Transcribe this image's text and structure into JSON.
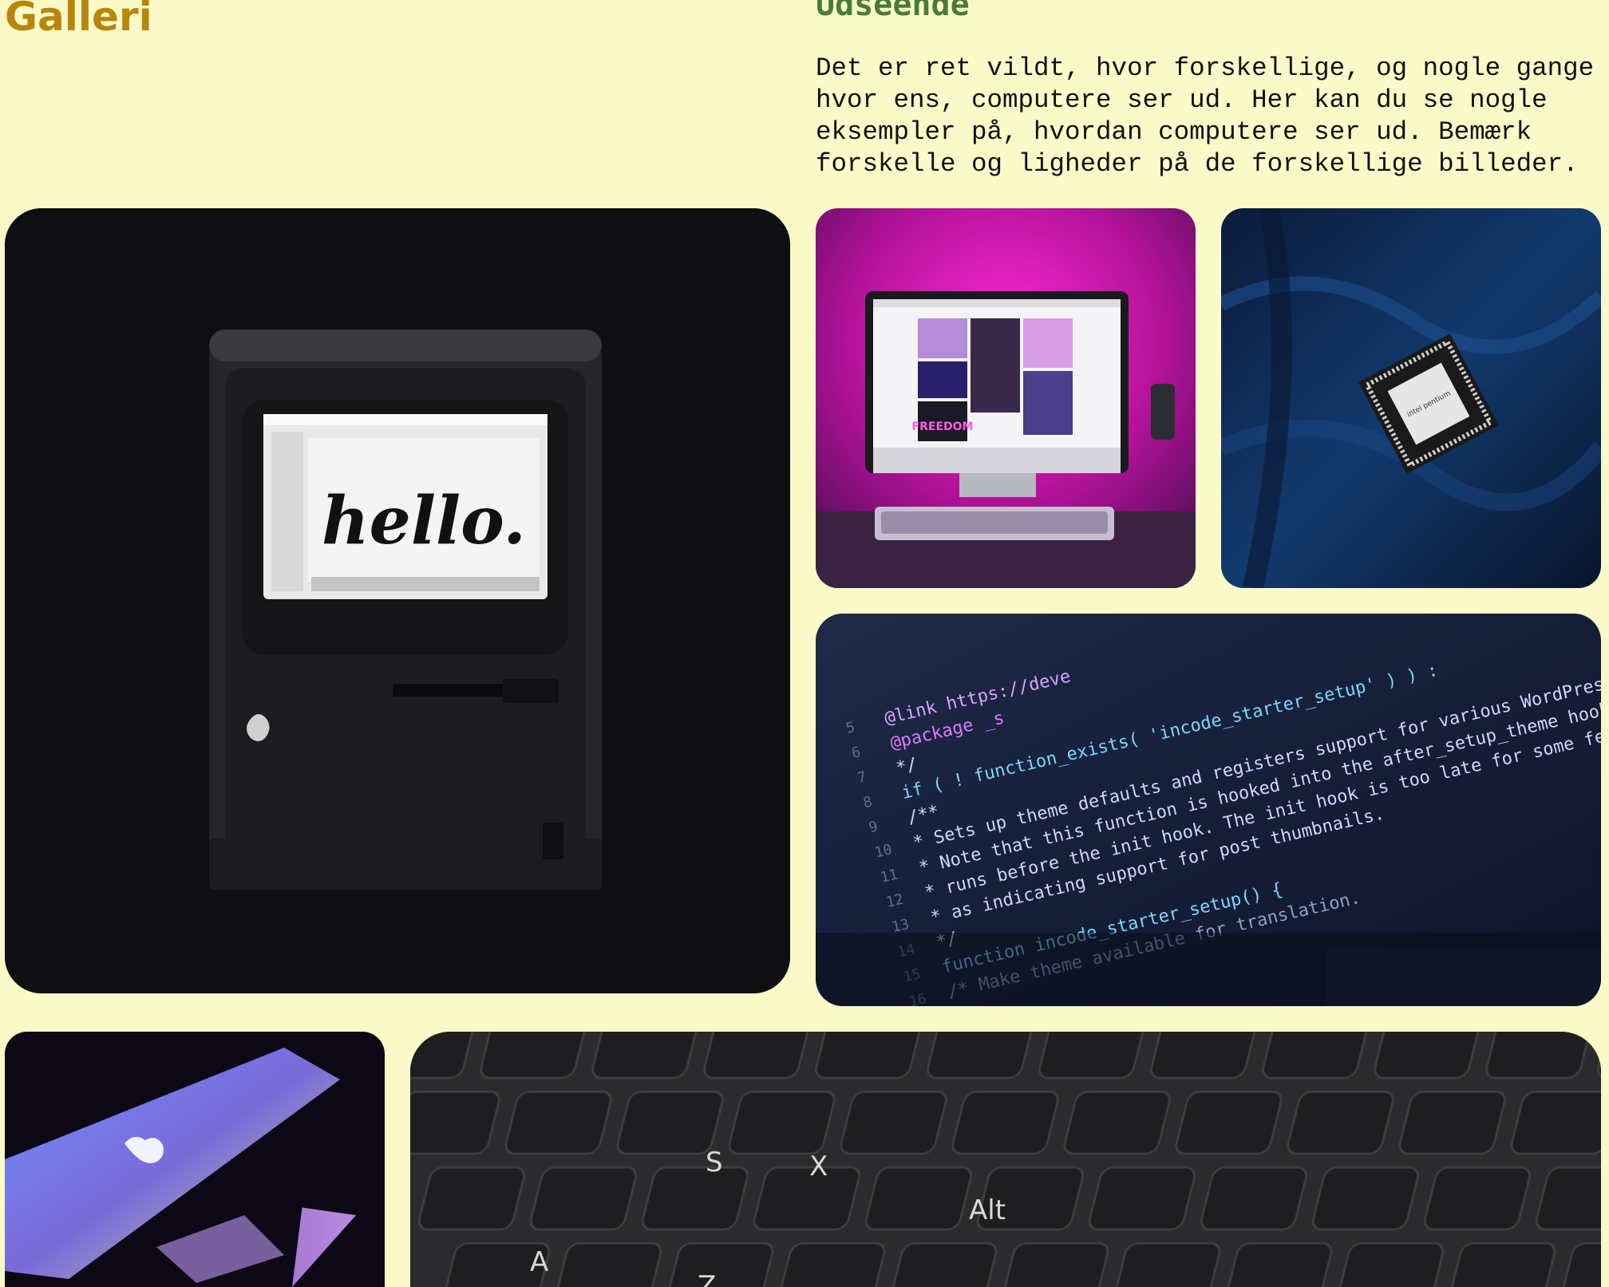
{
  "gallery": {
    "title": "Galleri"
  },
  "section": {
    "heading": "Udseende",
    "text": "Det er ret vildt, hvor forskellige, og nogle gange\nhvor ens, computere ser ud. Her kan du se nogle\neksempler på, hvordan computere ser ud. Bemærk\nforskelle og ligheder på de forskellige billeder."
  },
  "photos": {
    "mac": {
      "screen_text": "hello."
    },
    "imac": {
      "sticker_text": "FREEDOM"
    },
    "cpu": {
      "chip_text": "intel pentium"
    },
    "code": {
      "lines": [
        "@link https://deve",
        "@package _s",
        "*/",
        "if ( ! function_exists( 'incode_starter_setup' ) ) :",
        "/**",
        " * Sets up theme defaults and registers support for various WordPress features.",
        " * Note that this function is hooked into the after_setup_theme hook, which",
        " * runs before the init hook. The init hook is too late for some features, such",
        " * as indicating support for post thumbnails.",
        " */",
        "function incode_starter_setup() {",
        "  /* Make theme available for translation."
      ],
      "line_numbers": [
        "5",
        "6",
        "7",
        "8",
        "9",
        "10",
        "11",
        "12",
        "13",
        "14",
        "15",
        "16"
      ]
    },
    "keys": {
      "letters": [
        "A",
        "Z",
        "X",
        "S",
        "Alt"
      ]
    }
  },
  "colors": {
    "background": "#fafac8",
    "gallery_title": "#b8860b",
    "section_heading": "#4a7a3a"
  }
}
